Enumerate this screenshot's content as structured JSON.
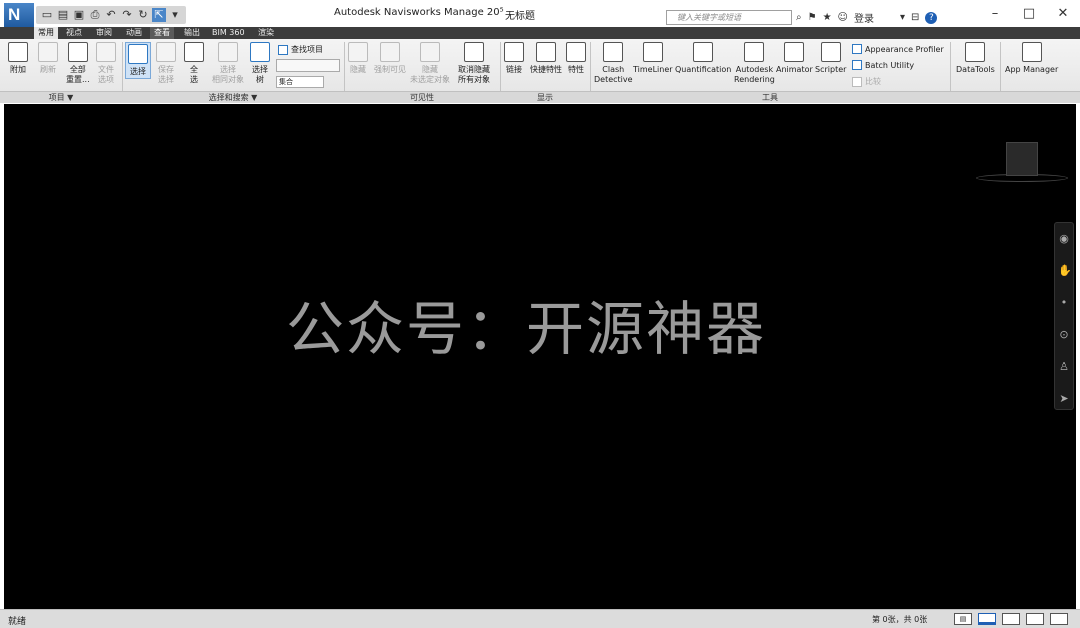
{
  "window": {
    "title": "Autodesk Navisworks Manage 20⁵",
    "subtitle": "无标题",
    "search_placeholder": "键入关键字或短语",
    "login_label": "登录",
    "logo_letter": "N",
    "controls": {
      "minimize": "–",
      "maximize": "□",
      "close": "✕"
    },
    "help_label": "?"
  },
  "tabs": [
    "常用",
    "视点",
    "审阅",
    "动画",
    "查看",
    "输出",
    "BIM 360",
    "渲染"
  ],
  "ribbon": {
    "project": {
      "append": "附加",
      "refresh": "刷新",
      "reset_all": "全部\n重置...",
      "file_options": "文件\n选项",
      "panel_label": "项目 ▼"
    },
    "select_search": {
      "select": "选择",
      "save_selection": "保存\n选择",
      "select_all": "全\n选",
      "select_same": "选择\n相同对象",
      "selection_tree": "选择\n树",
      "find_items": "查找项目",
      "sets_label": "集合",
      "panel_label": "选择和搜索 ▼"
    },
    "visibility": {
      "hide": "隐藏",
      "require": "强制可见",
      "hide_unselected": "隐藏\n未选定对象",
      "unhide_all": "取消隐藏\n所有对象",
      "panel_label": "可见性"
    },
    "display": {
      "links": "链接",
      "quick_properties": "快捷特性",
      "properties": "特性",
      "panel_label": "显示"
    },
    "tools": {
      "clash": "Clash\nDetective",
      "timeliner": "TimeLiner",
      "quantification": "Quantification",
      "rendering": "Autodesk\nRendering",
      "animator": "Animator",
      "scripter": "Scripter",
      "appearance_profiler": "Appearance Profiler",
      "batch_utility": "Batch Utility",
      "compare": "比较",
      "panel_label": "工具"
    },
    "datatools": "DataTools",
    "app_manager": "App Manager"
  },
  "viewport": {
    "watermark": "公众号：开源神器"
  },
  "statusbar": {
    "text": "就绪",
    "sheet_info": "第 0张，共 0张"
  }
}
